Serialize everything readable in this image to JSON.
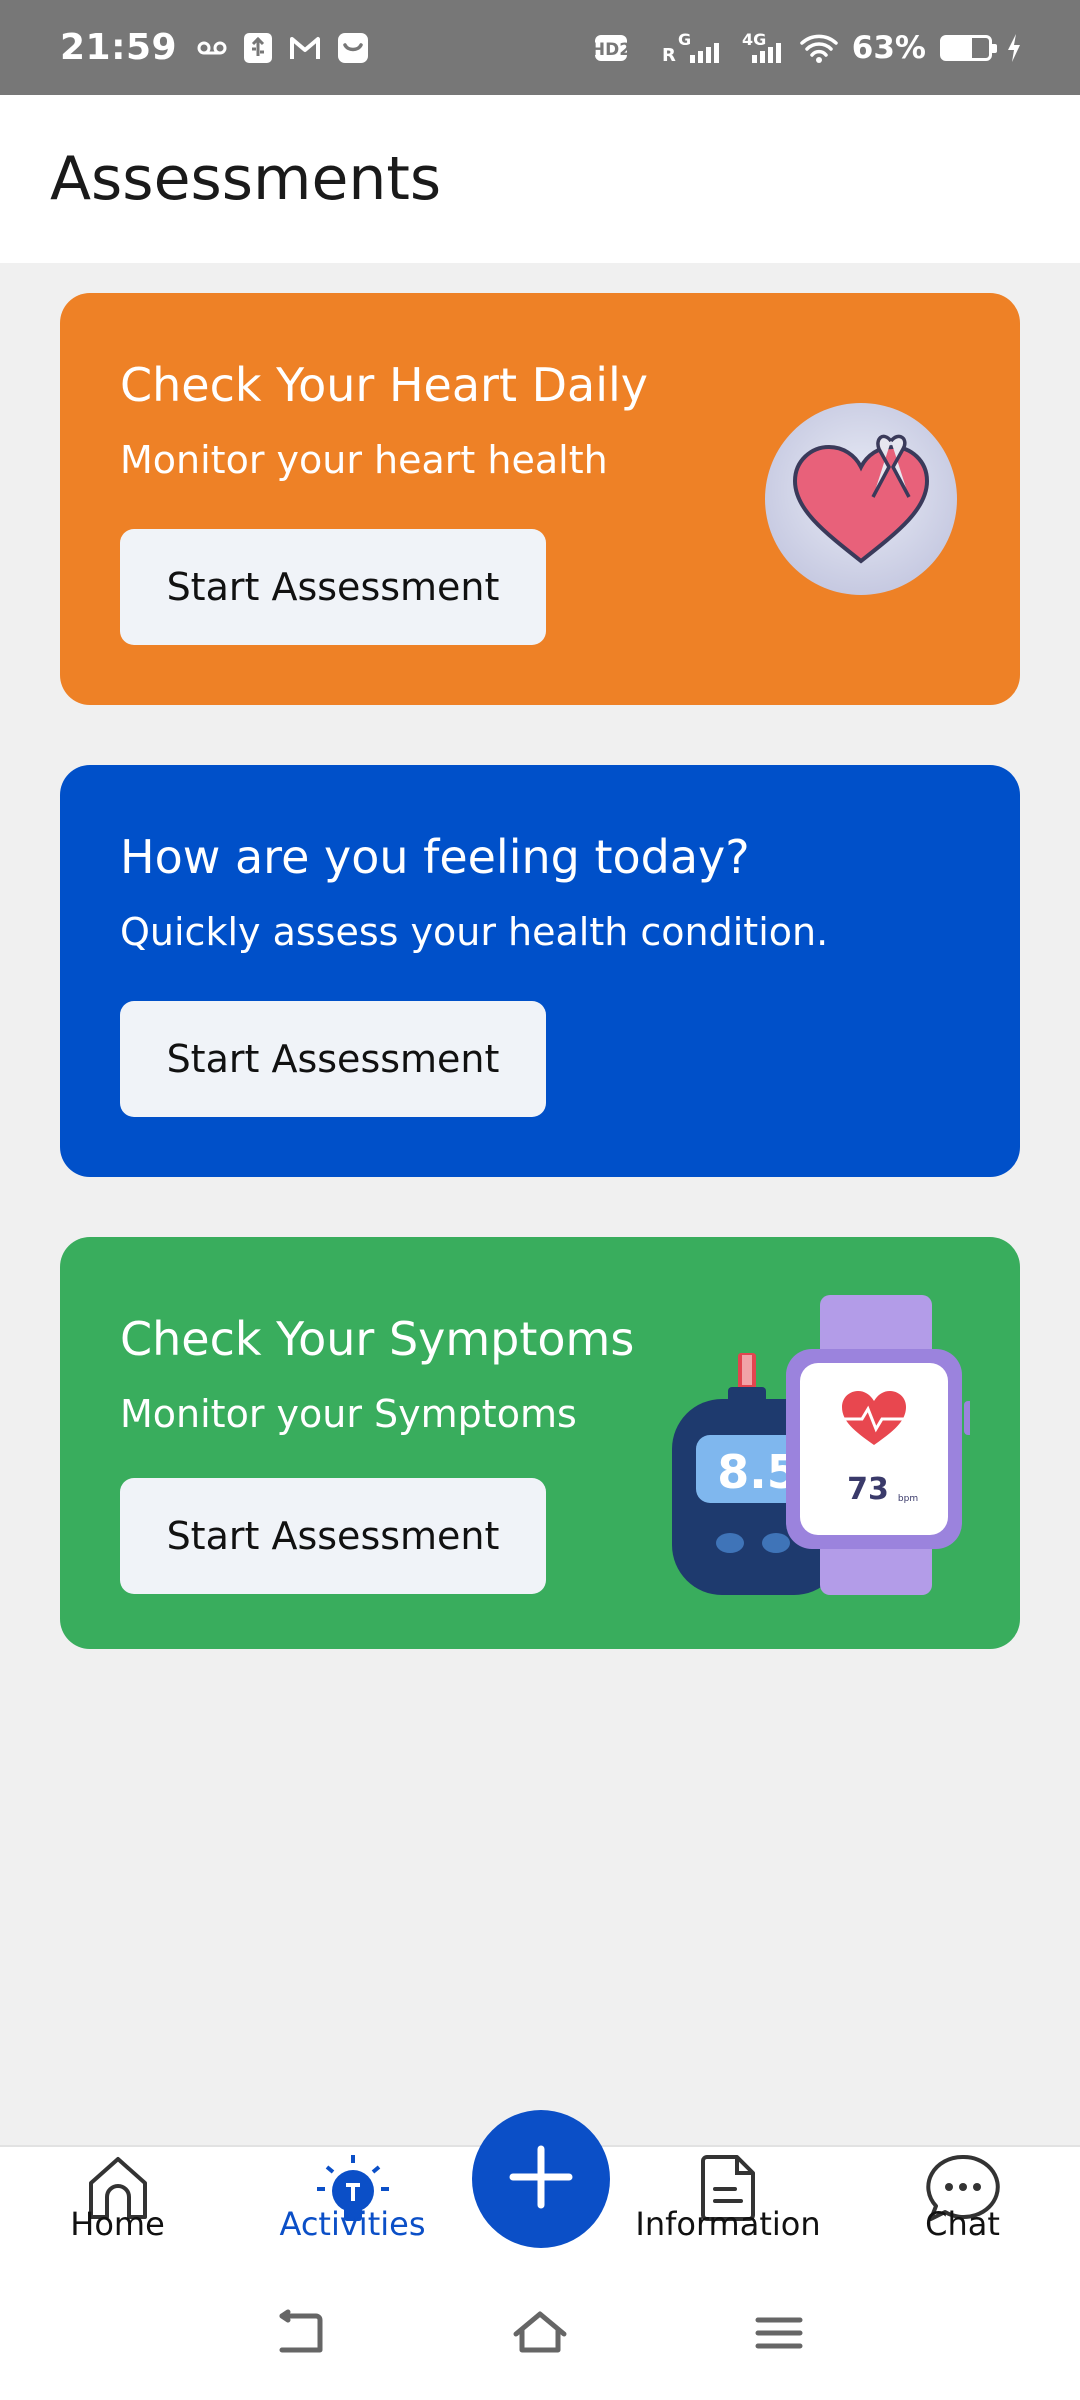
{
  "status_bar": {
    "time": "21:59",
    "battery_percent": "63%",
    "battery_level": 0.63,
    "network_labels": [
      "HD2",
      "R",
      "G",
      "4G"
    ],
    "icons": [
      "voicemail-icon",
      "usb-debug-icon",
      "gmail-icon",
      "notification-icon",
      "hd-voice-icon",
      "signal-icon",
      "signal-4g-icon",
      "wifi-icon",
      "battery-icon",
      "charging-icon"
    ]
  },
  "header": {
    "title": "Assessments"
  },
  "cards": [
    {
      "title": "Check Your Heart Daily",
      "subtitle": "Monitor your heart health",
      "button_label": "Start Assessment",
      "background": "#ee8126",
      "illustration": "heart-ribbon-icon"
    },
    {
      "title": "How are you feeling today?",
      "subtitle": "Quickly assess your health condition.",
      "button_label": "Start Assessment",
      "background": "#0050c9"
    },
    {
      "title": "Check Your Symptoms",
      "subtitle": "Monitor your Symptoms",
      "button_label": "Start Assessment",
      "background": "#39ad5d",
      "illustration": "glucometer-smartwatch-icon",
      "illustration_glucometer_value": "8.5",
      "illustration_watch_value": "73",
      "illustration_watch_unit": "bpm"
    }
  ],
  "bottom_nav": {
    "items": [
      {
        "label": "Home",
        "icon": "home-icon",
        "active": false
      },
      {
        "label": "Activities",
        "icon": "lightbulb-icon",
        "active": true
      },
      {
        "label": "Information",
        "icon": "document-icon",
        "active": false
      },
      {
        "label": "Chat",
        "icon": "chat-icon",
        "active": false
      }
    ],
    "fab_icon": "plus-icon",
    "accent": "#0b4fc7"
  },
  "system_nav": {
    "icons": [
      "back-icon",
      "home-outline-icon",
      "menu-icon"
    ]
  }
}
